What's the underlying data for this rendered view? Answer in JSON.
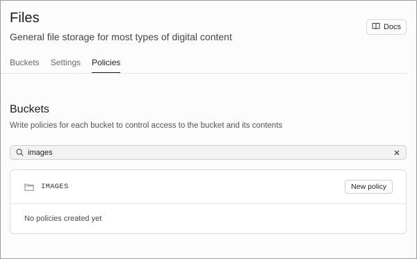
{
  "header": {
    "title": "Files",
    "subtitle": "General file storage for most types of digital content",
    "docs_label": "Docs"
  },
  "tabs": [
    {
      "label": "Buckets",
      "active": false
    },
    {
      "label": "Settings",
      "active": false
    },
    {
      "label": "Policies",
      "active": true
    }
  ],
  "section": {
    "title": "Buckets",
    "description": "Write policies for each bucket to control access to the bucket and its contents"
  },
  "search": {
    "value": "images",
    "icon": "search-icon",
    "clear_icon": "close-icon"
  },
  "bucket": {
    "name": "IMAGES",
    "icon": "folder-icon",
    "new_policy_label": "New policy",
    "empty_text": "No policies created yet"
  },
  "colors": {
    "text_primary": "#1c1c1c",
    "text_muted": "#6a6a6a",
    "border": "#dcdcdc",
    "search_bg": "#f3f3f3"
  }
}
